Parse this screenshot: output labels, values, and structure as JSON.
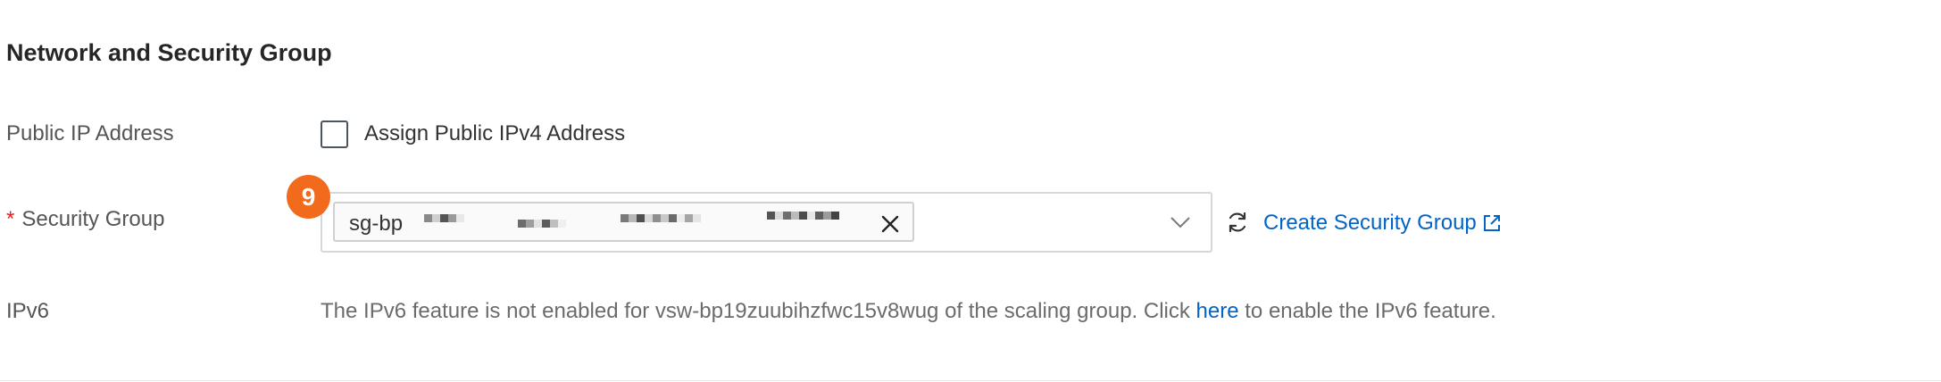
{
  "section": {
    "title": "Network and Security Group"
  },
  "public_ip": {
    "label": "Public IP Address",
    "checkbox_label": "Assign Public IPv4 Address",
    "checked": false
  },
  "security_group": {
    "required_mark": "*",
    "label": "Security Group",
    "step_badge": "9",
    "selected_tag_prefix": "sg-bp",
    "create_link": "Create Security Group",
    "accent_color": "#0064c8",
    "badge_color": "#f26a1b"
  },
  "ipv6": {
    "label": "IPv6",
    "message_before": "The IPv6 feature is not enabled for vsw-bp19zuubihzfwc15v8wug of the scaling group. Click ",
    "link_text": "here",
    "message_after": " to enable the IPv6 feature."
  },
  "icons": {
    "checkbox": "checkbox-icon",
    "tag_close": "close-icon",
    "dropdown": "chevron-down-icon",
    "refresh": "refresh-icon",
    "external": "external-link-icon"
  }
}
